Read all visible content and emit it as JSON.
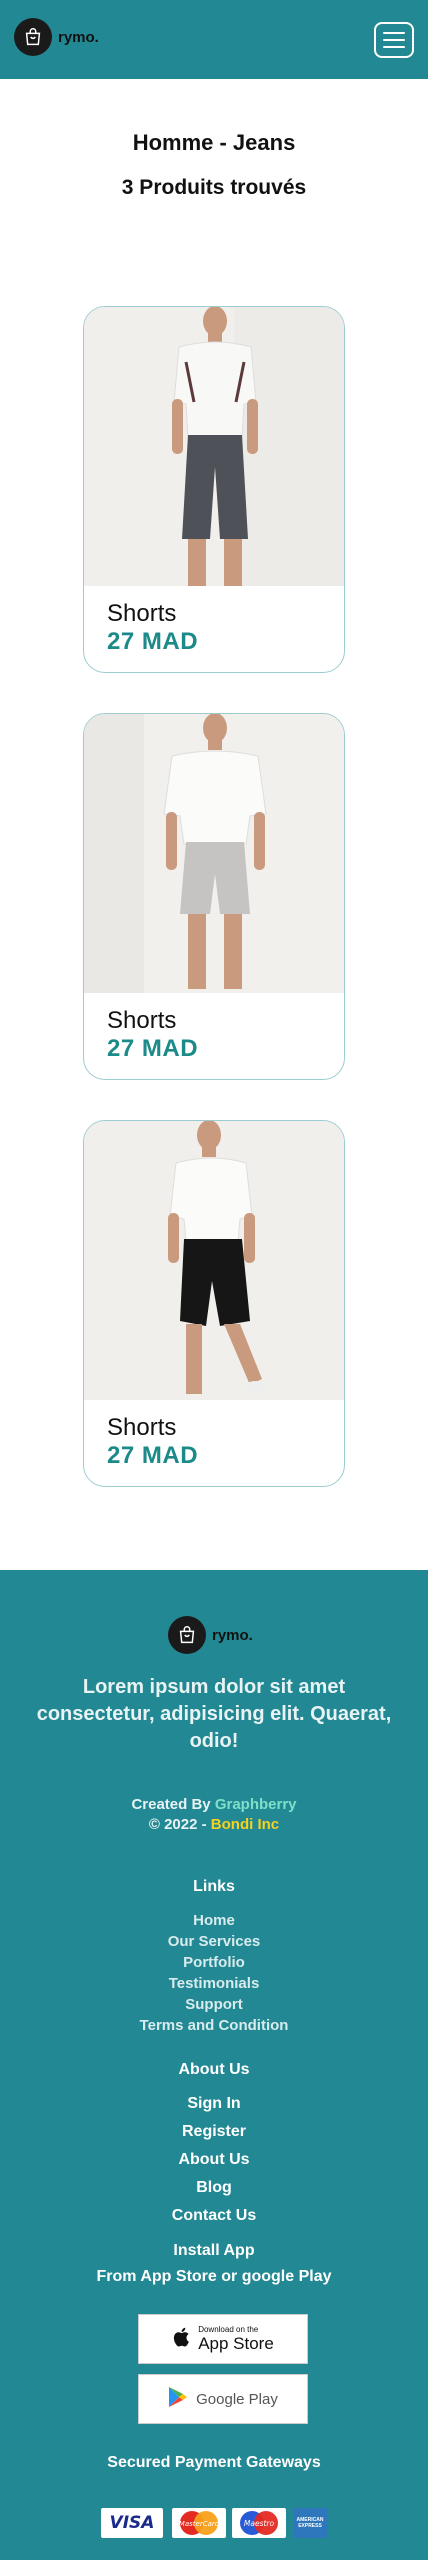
{
  "header": {
    "logo_text": "rymo."
  },
  "page": {
    "title": "Homme - Jeans",
    "results": "3 Produits trouvés"
  },
  "products": [
    {
      "name": "Shorts",
      "price": "27 MAD"
    },
    {
      "name": "Shorts",
      "price": "27 MAD"
    },
    {
      "name": "Shorts",
      "price": "27 MAD"
    }
  ],
  "footer": {
    "logo_text": "rymo.",
    "tagline": "Lorem ipsum dolor sit amet consectetur, adipisicing elit. Quaerat, odio!",
    "created_by_prefix": "Created By ",
    "created_by_brand": "Graphberry",
    "copyright_prefix": "© 2022 - ",
    "copyright_brand": "Bondi Inc",
    "links_heading": "Links",
    "links": [
      "Home",
      "Our Services",
      "Portfolio",
      "Testimonials",
      "Support",
      "Terms and Condition"
    ],
    "about_heading": "About Us",
    "about_links": [
      "Sign In",
      "Register",
      "About Us",
      "Blog",
      "Contact Us"
    ],
    "install_heading": "Install App",
    "install_sub": "From App Store or google Play",
    "appstore_small": "Download on the",
    "appstore_big": "App Store",
    "googleplay_label": "Google Play",
    "payment_heading": "Secured Payment Gateways",
    "payment_visa": "VISA",
    "payment_mastercard": "MasterCard",
    "payment_maestro": "Maestro",
    "payment_amex": "AMERICAN EXPRESS"
  },
  "colors": {
    "teal": "#228893",
    "price": "#1b8a88",
    "graphberry": "#7ee0c9",
    "bondi": "#f5d21f"
  }
}
